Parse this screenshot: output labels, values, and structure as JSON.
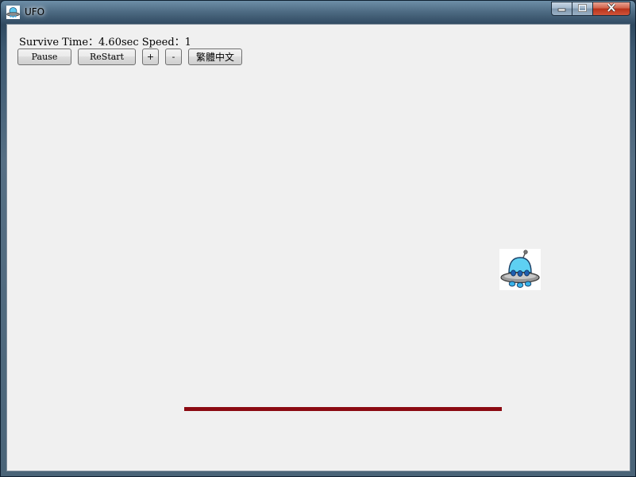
{
  "window": {
    "title": "UFO",
    "icon": "ufo-icon",
    "caption_buttons": [
      "minimize-icon",
      "maximize-icon",
      "close-icon"
    ]
  },
  "status": {
    "text": "Survive Time：4.60sec Speed：1"
  },
  "toolbar": {
    "pause_label": "Pause",
    "restart_label": "ReStart",
    "plus_label": "+",
    "minus_label": "-",
    "language_label": "繁體中文"
  },
  "game": {
    "ufo_icon": "ufo-sprite",
    "paddle_color": "#8b0a12",
    "background_color": "#f0f0f0"
  }
}
